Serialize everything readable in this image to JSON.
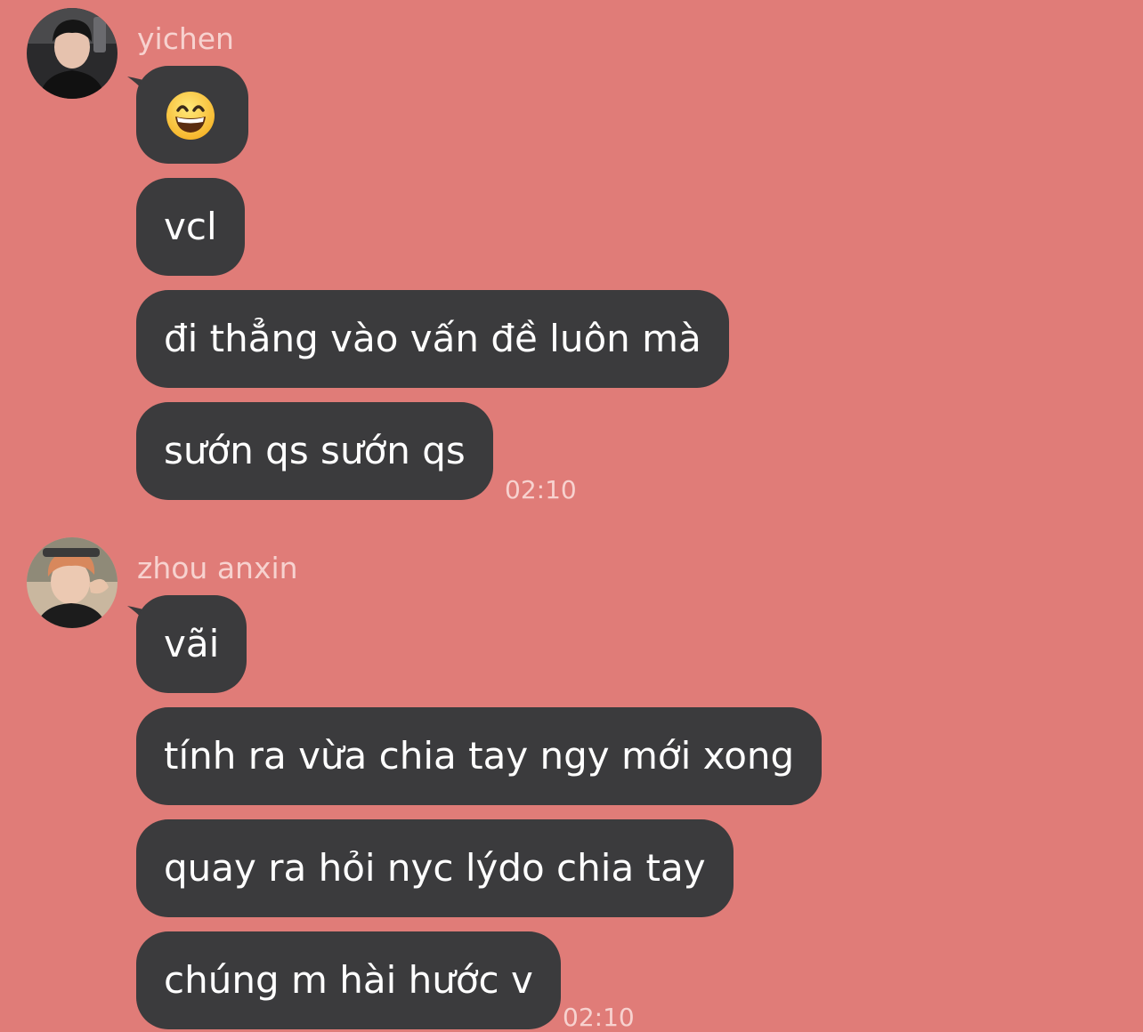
{
  "groups": [
    {
      "sender": "yichen",
      "messages": [
        {
          "text": "😄",
          "type": "emoji",
          "icon": "grinning-face-emoji"
        },
        {
          "text": "vcl"
        },
        {
          "text": "đi thẳng vào vấn đề luôn mà"
        },
        {
          "text": "sướn qs sướn qs"
        }
      ],
      "time": "02:10"
    },
    {
      "sender": "zhou anxin",
      "messages": [
        {
          "text": "vãi"
        },
        {
          "text": "tính ra vừa chia tay ngy mới xong"
        },
        {
          "text": "quay ra hỏi nyc lýdo chia tay"
        },
        {
          "text": "chúng m hài hước v"
        }
      ],
      "time": "02:10"
    }
  ],
  "colors": {
    "background": "#e07c78",
    "bubble": "#3b3b3d",
    "bubble_text": "#ffffff",
    "meta_text": "#f7d2cf"
  }
}
